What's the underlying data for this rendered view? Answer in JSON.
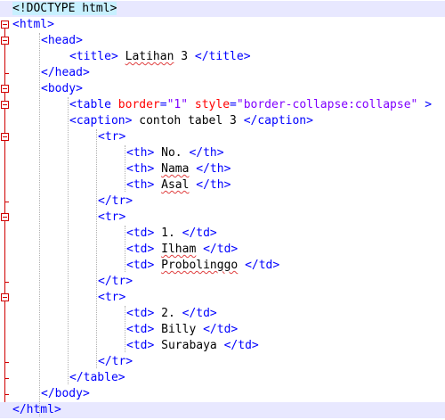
{
  "editor": {
    "lines": [
      {
        "indent": 0,
        "parts": [
          {
            "t": "<!DOCTYPE html>",
            "c": "doctype"
          }
        ]
      },
      {
        "indent": 0,
        "parts": [
          {
            "t": "<html>",
            "c": "tag"
          }
        ]
      },
      {
        "indent": 1,
        "parts": [
          {
            "t": "<head>",
            "c": "tag"
          }
        ]
      },
      {
        "indent": 2,
        "parts": [
          {
            "t": "<title>",
            "c": "tag"
          },
          {
            "t": " ",
            "c": "text"
          },
          {
            "t": "Latihan",
            "c": "text squiggle"
          },
          {
            "t": " 3 ",
            "c": "text"
          },
          {
            "t": "</title>",
            "c": "tag"
          }
        ]
      },
      {
        "indent": 1,
        "parts": [
          {
            "t": "</head>",
            "c": "tag"
          }
        ]
      },
      {
        "indent": 1,
        "parts": [
          {
            "t": "<body>",
            "c": "tag"
          }
        ]
      },
      {
        "indent": 2,
        "parts": [
          {
            "t": "<table ",
            "c": "tag"
          },
          {
            "t": "border",
            "c": "attr"
          },
          {
            "t": "=",
            "c": "tag"
          },
          {
            "t": "\"1\"",
            "c": "val"
          },
          {
            "t": " ",
            "c": "tag"
          },
          {
            "t": "style",
            "c": "attr"
          },
          {
            "t": "=",
            "c": "tag"
          },
          {
            "t": "\"border-collapse:collapse\"",
            "c": "val"
          },
          {
            "t": " >",
            "c": "tag"
          }
        ]
      },
      {
        "indent": 2,
        "parts": [
          {
            "t": "<caption>",
            "c": "tag"
          },
          {
            "t": " contoh tabel 3 ",
            "c": "text"
          },
          {
            "t": "</caption>",
            "c": "tag"
          }
        ]
      },
      {
        "indent": 3,
        "parts": [
          {
            "t": "<tr>",
            "c": "tag"
          }
        ]
      },
      {
        "indent": 4,
        "parts": [
          {
            "t": "<th>",
            "c": "tag"
          },
          {
            "t": " No. ",
            "c": "text"
          },
          {
            "t": "</th>",
            "c": "tag"
          }
        ]
      },
      {
        "indent": 4,
        "parts": [
          {
            "t": "<th>",
            "c": "tag"
          },
          {
            "t": " ",
            "c": "text"
          },
          {
            "t": "Nama",
            "c": "text squiggle"
          },
          {
            "t": " ",
            "c": "text"
          },
          {
            "t": "</th>",
            "c": "tag"
          }
        ]
      },
      {
        "indent": 4,
        "parts": [
          {
            "t": "<th>",
            "c": "tag"
          },
          {
            "t": " ",
            "c": "text"
          },
          {
            "t": "Asal",
            "c": "text squiggle"
          },
          {
            "t": " ",
            "c": "text"
          },
          {
            "t": "</th>",
            "c": "tag"
          }
        ]
      },
      {
        "indent": 3,
        "parts": [
          {
            "t": "</tr>",
            "c": "tag"
          }
        ]
      },
      {
        "indent": 3,
        "parts": [
          {
            "t": "<tr>",
            "c": "tag"
          }
        ]
      },
      {
        "indent": 4,
        "parts": [
          {
            "t": "<td>",
            "c": "tag"
          },
          {
            "t": " 1. ",
            "c": "text"
          },
          {
            "t": "</td>",
            "c": "tag"
          }
        ]
      },
      {
        "indent": 4,
        "parts": [
          {
            "t": "<td>",
            "c": "tag"
          },
          {
            "t": " ",
            "c": "text"
          },
          {
            "t": "Ilham",
            "c": "text squiggle"
          },
          {
            "t": " ",
            "c": "text"
          },
          {
            "t": "</td>",
            "c": "tag"
          }
        ]
      },
      {
        "indent": 4,
        "parts": [
          {
            "t": "<td>",
            "c": "tag"
          },
          {
            "t": " ",
            "c": "text"
          },
          {
            "t": "Probolinggo",
            "c": "text squiggle"
          },
          {
            "t": " ",
            "c": "text"
          },
          {
            "t": "</td>",
            "c": "tag"
          }
        ]
      },
      {
        "indent": 3,
        "parts": [
          {
            "t": "</tr>",
            "c": "tag"
          }
        ]
      },
      {
        "indent": 3,
        "parts": [
          {
            "t": "<tr>",
            "c": "tag"
          }
        ]
      },
      {
        "indent": 4,
        "parts": [
          {
            "t": "<td>",
            "c": "tag"
          },
          {
            "t": " 2. ",
            "c": "text"
          },
          {
            "t": "</td>",
            "c": "tag"
          }
        ]
      },
      {
        "indent": 4,
        "parts": [
          {
            "t": "<td>",
            "c": "tag"
          },
          {
            "t": " Billy ",
            "c": "text"
          },
          {
            "t": "</td>",
            "c": "tag"
          }
        ]
      },
      {
        "indent": 4,
        "parts": [
          {
            "t": "<td>",
            "c": "tag"
          },
          {
            "t": " Surabaya ",
            "c": "text"
          },
          {
            "t": "</td>",
            "c": "tag"
          }
        ]
      },
      {
        "indent": 3,
        "parts": [
          {
            "t": "</tr>",
            "c": "tag"
          }
        ]
      },
      {
        "indent": 2,
        "parts": [
          {
            "t": "</table>",
            "c": "tag"
          }
        ]
      },
      {
        "indent": 1,
        "parts": [
          {
            "t": "</body>",
            "c": "tag"
          }
        ]
      },
      {
        "indent": 0,
        "parts": [
          {
            "t": "</html>",
            "c": "tag"
          }
        ]
      }
    ],
    "colors": {
      "tag": "#0000ff",
      "attribute": "#ff0000",
      "value": "#8000ff",
      "text": "#000000",
      "fold_marker": "#d00000",
      "doctype_highlight": "#c8f0ff",
      "active_line": "#e8e8ff"
    },
    "icons": {
      "fold": "fold-toggle-icon"
    }
  }
}
